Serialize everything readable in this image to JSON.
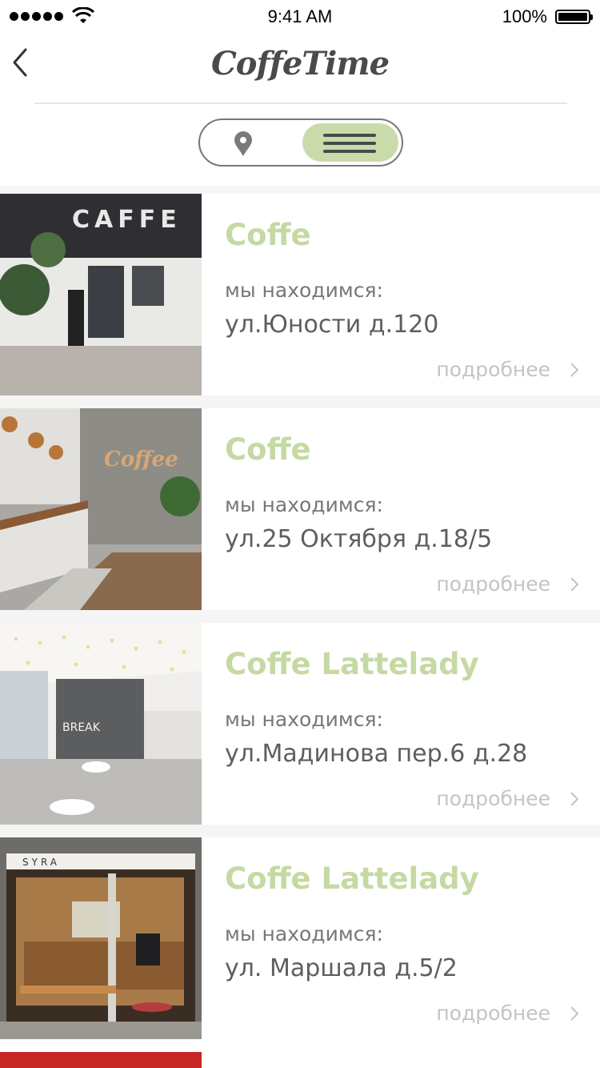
{
  "status_bar": {
    "time": "9:41 AM",
    "battery": "100%"
  },
  "header": {
    "logo": "CoffeTime"
  },
  "view_toggle": {
    "options": [
      "map-pin-icon",
      "list-icon"
    ],
    "selected": "list"
  },
  "cafes": [
    {
      "name": "Coffe",
      "location_label": "мы находимся:",
      "address": "ул.Юности д.120",
      "more": "подробнее",
      "sign_text": "CAFFE"
    },
    {
      "name": "Coffe",
      "location_label": "мы находимся:",
      "address": "ул.25 Октября д.18/5",
      "more": "подробнее",
      "sign_text": "Coffee"
    },
    {
      "name": "Coffe Lattelady",
      "location_label": "мы находимся:",
      "address": "ул.Мадинова пер.6 д.28",
      "more": "подробнее",
      "sign_text": "BREAK"
    },
    {
      "name": "Coffe Lattelady",
      "location_label": "мы находимся:",
      "address": "ул. Маршала д.5/2",
      "more": "подробнее",
      "sign_text": "SYRA"
    }
  ],
  "colors": {
    "accent": "#c5d9a3",
    "toggle_active": "#c9dbab",
    "text_gray": "#5e5e5e"
  }
}
